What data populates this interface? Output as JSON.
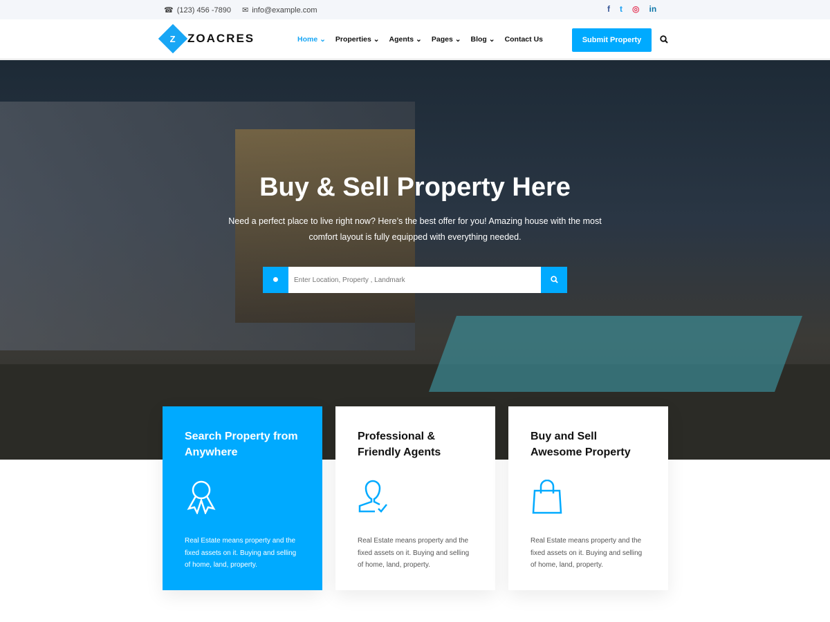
{
  "topbar": {
    "phone": "(123) 456 -7890",
    "email": "info@example.com",
    "social": [
      {
        "icon": "facebook-icon",
        "glyph": "f",
        "color": "#3b5998"
      },
      {
        "icon": "twitter-icon",
        "glyph": "t",
        "color": "#1da1f2"
      },
      {
        "icon": "instagram-icon",
        "glyph": "◎",
        "color": "#e4405f"
      },
      {
        "icon": "linkedin-icon",
        "glyph": "in",
        "color": "#0e76a8"
      }
    ]
  },
  "nav": {
    "logo": "ZOACRES",
    "logo_letter": "Z",
    "items": [
      {
        "label": "Home ⌄",
        "active": true
      },
      {
        "label": "Properties ⌄"
      },
      {
        "label": "Agents ⌄"
      },
      {
        "label": "Pages ⌄"
      },
      {
        "label": "Blog ⌄"
      },
      {
        "label": "Contact Us"
      }
    ],
    "submit": "Submit Property"
  },
  "hero": {
    "title": "Buy & Sell Property Here",
    "subtitle": "Need a perfect place to live right now? Here’s the best offer for you! Amazing house with the most comfort layout is fully equipped with everything needed.",
    "search_placeholder": "Enter Location, Property , Landmark"
  },
  "cards": [
    {
      "title": "Search Property from Anywhere",
      "icon": "award-icon",
      "text": "Real Estate means property and the fixed assets on it. Buying and selling of home, land, property."
    },
    {
      "title": "Professional & Friendly Agents",
      "icon": "user-check-icon",
      "text": "Real Estate means property and the fixed assets on it. Buying and selling of home, land, property."
    },
    {
      "title": "Buy and Sell Awesome Property",
      "icon": "shopping-bag-icon",
      "text": "Real Estate means property and the fixed assets on it. Buying and selling of home, land, property."
    }
  ],
  "colors": {
    "accent": "#00aaff"
  }
}
